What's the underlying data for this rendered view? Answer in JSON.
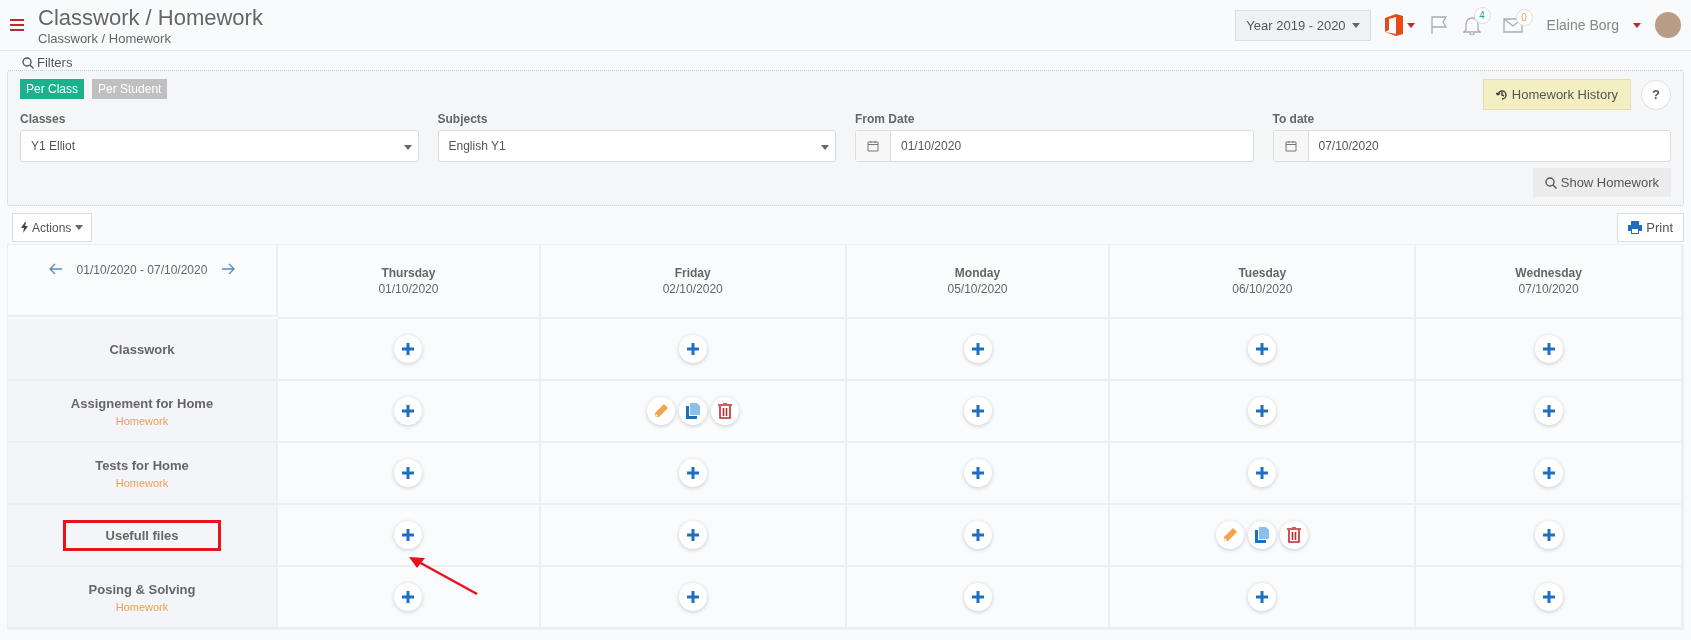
{
  "header": {
    "title": "Classwork / Homework",
    "breadcrumb": "Classwork / Homework",
    "year": "Year 2019 - 2020",
    "notifications": "4",
    "messages": "0",
    "user": "Elaine Borg"
  },
  "filters": {
    "title": "Filters",
    "modes": [
      {
        "label": "Per Class",
        "selected": true
      },
      {
        "label": "Per Student",
        "selected": false
      }
    ],
    "history_button": "Homework History",
    "help": "?",
    "fields": [
      {
        "kind": "select",
        "label": "Classes",
        "value": "Y1 Elliot"
      },
      {
        "kind": "select",
        "label": "Subjects",
        "value": "English Y1"
      },
      {
        "kind": "date",
        "label": "From Date",
        "value": "01/10/2020"
      },
      {
        "kind": "date",
        "label": "To date",
        "value": "07/10/2020"
      }
    ],
    "show_button": "Show Homework"
  },
  "actions_button": "Actions",
  "print_button": "Print",
  "grid": {
    "range": "01/10/2020 - 07/10/2020",
    "days": [
      {
        "name": "Thursday",
        "date": "01/10/2020"
      },
      {
        "name": "Friday",
        "date": "02/10/2020"
      },
      {
        "name": "Monday",
        "date": "05/10/2020"
      },
      {
        "name": "Tuesday",
        "date": "06/10/2020"
      },
      {
        "name": "Wednesday",
        "date": "07/10/2020"
      }
    ],
    "rows": [
      {
        "label": "Classwork",
        "highlighted": false,
        "cells": [
          {
            "kind": "add"
          },
          {
            "kind": "add"
          },
          {
            "kind": "add"
          },
          {
            "kind": "add"
          },
          {
            "kind": "add"
          }
        ]
      },
      {
        "label": "Assignement for Home",
        "sub": "Homework",
        "highlighted": false,
        "cells": [
          {
            "kind": "add"
          },
          {
            "kind": "entry"
          },
          {
            "kind": "add"
          },
          {
            "kind": "add"
          },
          {
            "kind": "add"
          }
        ]
      },
      {
        "label": "Tests for Home",
        "sub": "Homework",
        "highlighted": false,
        "cells": [
          {
            "kind": "add"
          },
          {
            "kind": "add"
          },
          {
            "kind": "add"
          },
          {
            "kind": "add"
          },
          {
            "kind": "add"
          }
        ]
      },
      {
        "label": "Usefull files",
        "highlighted": true,
        "cells": [
          {
            "kind": "add"
          },
          {
            "kind": "add"
          },
          {
            "kind": "add"
          },
          {
            "kind": "entry"
          },
          {
            "kind": "add"
          }
        ]
      },
      {
        "label": "Posing & Solving",
        "sub": "Homework",
        "highlighted": false,
        "cells": [
          {
            "kind": "add"
          },
          {
            "kind": "add"
          },
          {
            "kind": "add"
          },
          {
            "kind": "add"
          },
          {
            "kind": "add"
          }
        ]
      }
    ]
  }
}
